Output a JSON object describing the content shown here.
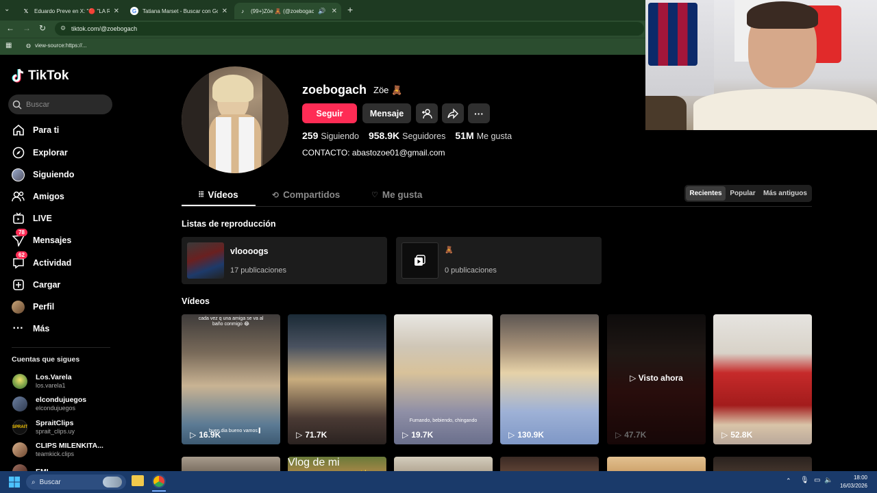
{
  "browser": {
    "tabs": [
      {
        "title": "Eduardo Preve en X: \"🔴 \"LA R",
        "icon": "x-logo-icon"
      },
      {
        "title": "Tatiana Marset - Buscar con Go",
        "icon": "google-icon"
      },
      {
        "title": "(99+)Zöe 🧸 (@zoebogach",
        "icon": "tiktok-icon"
      }
    ],
    "url": "tiktok.com/@zoebogach",
    "bookmark": "view-source:https://..."
  },
  "sidebar": {
    "brand": "TikTok",
    "search_placeholder": "Buscar",
    "items": [
      {
        "label": "Para ti",
        "icon": "home-icon"
      },
      {
        "label": "Explorar",
        "icon": "compass-icon"
      },
      {
        "label": "Siguiendo",
        "icon": "following-icon"
      },
      {
        "label": "Amigos",
        "icon": "friends-icon"
      },
      {
        "label": "LIVE",
        "icon": "live-icon"
      },
      {
        "label": "Mensajes",
        "icon": "messages-icon",
        "badge": "78"
      },
      {
        "label": "Actividad",
        "icon": "activity-icon",
        "badge": "62"
      },
      {
        "label": "Cargar",
        "icon": "upload-icon"
      },
      {
        "label": "Perfil",
        "icon": "profile-icon"
      },
      {
        "label": "Más",
        "icon": "more-icon"
      }
    ],
    "following_title": "Cuentas que sigues",
    "following": [
      {
        "name": "Los.Varela",
        "handle": "los.varela1"
      },
      {
        "name": "elcondujuegos",
        "handle": "elcondujuegos"
      },
      {
        "name": "SpraitClips",
        "handle": "sprait_clips.uy"
      },
      {
        "name": "CLIPS MILENKITA...",
        "handle": "teamkick.clips"
      },
      {
        "name": "EMI",
        "handle": ""
      }
    ]
  },
  "profile": {
    "username": "zoebogach",
    "nickname": "Zöe 🧸",
    "follow_label": "Seguir",
    "message_label": "Mensaje",
    "stats": [
      {
        "value": "259",
        "label": "Siguiendo"
      },
      {
        "value": "958.9K",
        "label": "Seguidores"
      },
      {
        "value": "51M",
        "label": "Me gusta"
      }
    ],
    "bio": "CONTACTO: abastozoe01@gmail.com"
  },
  "tabs": {
    "videos": "Vídeos",
    "shared": "Compartidos",
    "likes": "Me gusta"
  },
  "sort": {
    "options": [
      "Recientes",
      "Popular",
      "Más antiguos"
    ],
    "selected": "Recientes"
  },
  "playlists": {
    "title": "Listas de reproducción",
    "items": [
      {
        "title": "vloooogs",
        "count": "17 publicaciones"
      },
      {
        "title": "🧸",
        "count": "0 publicaciones"
      }
    ]
  },
  "videos": {
    "title": "Vídeos",
    "items": [
      {
        "views": "16.9K",
        "caption_top": "cada vez q una amiga se va al baño conmigo 😂",
        "caption_bottom": "buen dia bueno vamos ▍"
      },
      {
        "views": "71.7K",
        "caption_top": "",
        "caption_bottom": ""
      },
      {
        "views": "19.7K",
        "caption_top": "",
        "caption_bottom": "Fumando, bebiendo, chingando"
      },
      {
        "views": "130.9K",
        "caption_top": "",
        "caption_bottom": ""
      },
      {
        "views": "47.7K",
        "caption_top": "",
        "caption_bottom": "",
        "overlay": "Visto ahora"
      },
      {
        "views": "52.8K",
        "caption_top": "",
        "caption_bottom": ""
      }
    ],
    "row2_captions": [
      "",
      "Vlog de mi cumpleeeeee ✨",
      "",
      "",
      "",
      ""
    ]
  },
  "taskbar": {
    "search": "Buscar",
    "time": "18:00",
    "date": "16/03/2026"
  },
  "colors": {
    "accent": "#fe2c55",
    "browser_green": "#2b4d2f",
    "taskbar_blue": "#1a3a6a"
  }
}
